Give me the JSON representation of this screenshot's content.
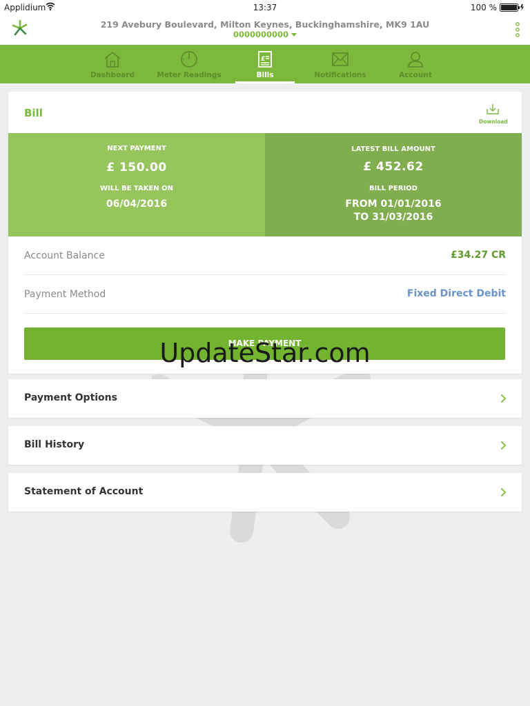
{
  "status_bar": {
    "carrier": "Applidium",
    "time": "13:37",
    "battery": "100 %"
  },
  "header": {
    "address": "219 Avebury Boulevard, Milton Keynes, Buckinghamshire, MK9 1AU",
    "account_number": "0000000000"
  },
  "nav": {
    "tabs": [
      {
        "label": "Dashboard",
        "icon": "house-icon"
      },
      {
        "label": "Meter Readings",
        "icon": "meter-dial-icon"
      },
      {
        "label": "Bills",
        "icon": "bill-icon"
      },
      {
        "label": "Notifications",
        "icon": "envelope-icon"
      },
      {
        "label": "Account",
        "icon": "user-icon"
      }
    ],
    "active": "Bills"
  },
  "bill": {
    "title": "Bill",
    "download_label": "Download",
    "next_payment_caption": "NEXT PAYMENT",
    "next_payment_amount": "£ 150.00",
    "taken_on_caption": "WILL BE TAKEN ON",
    "taken_on_date": "06/04/2016",
    "latest_bill_caption": "LATEST BILL  AMOUNT",
    "latest_bill_amount": "£ 452.62",
    "bill_period_caption": "BILL PERIOD",
    "bill_period_from": "FROM 01/01/2016",
    "bill_period_to": "TO 31/03/2016",
    "account_balance_label": "Account Balance",
    "account_balance_value": "£34.27 CR",
    "payment_method_label": "Payment Method",
    "payment_method_value": "Fixed Direct Debit",
    "make_payment_label": "MAKE PAYMENT"
  },
  "links": [
    {
      "label": "Payment Options"
    },
    {
      "label": "Bill History"
    },
    {
      "label": "Statement of Account"
    }
  ],
  "watermark": "UpdateStar.com",
  "colors": {
    "brand_green": "#7cb83b",
    "link_blue": "#6a93c8"
  }
}
